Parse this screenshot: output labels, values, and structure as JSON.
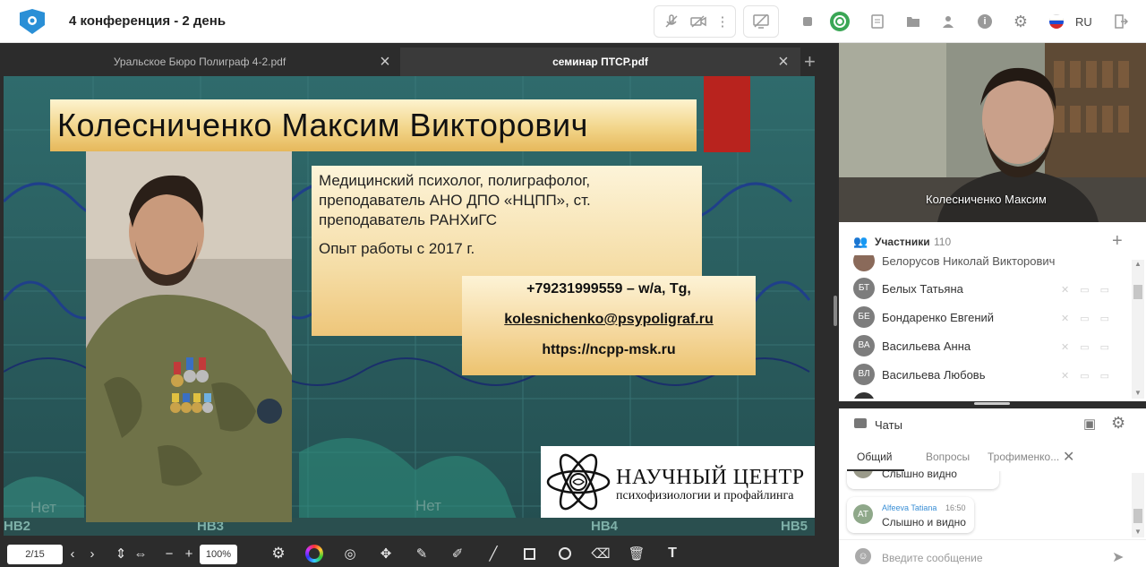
{
  "header": {
    "title": "4 конференция - 2 день",
    "lang": "RU",
    "accent": "#3aa655"
  },
  "doc_tabs": [
    {
      "label": "Уральское Бюро Полиграф 4-2.pdf",
      "active": false
    },
    {
      "label": "семинар ПТСР.pdf",
      "active": true
    }
  ],
  "slide": {
    "name": "Колесниченко Максим Викторович",
    "desc_line1": "Медицинский психолог, полиграфолог,",
    "desc_line2": "преподаватель АНО ДПО «НЦПП», ст.",
    "desc_line3": "преподаватель РАНХиГС",
    "experience": "Опыт работы с 2017 г.",
    "phone": "+79231999559 – w/a, Tg,",
    "email": "kolesnichenko@psypoligraf.ru",
    "website": "https://ncpp-msk.ru",
    "logo_title": "НАУЧНЫЙ ЦЕНТР",
    "logo_subtitle": "психофизиологии и профайлинга",
    "bg_labels": [
      "НВ2",
      "НВ3",
      "НВ4",
      "НВ5",
      "Нет",
      "Нет"
    ]
  },
  "toolbar": {
    "page": "2/15",
    "zoom": "100%"
  },
  "video": {
    "label": "Колесниченко Максим"
  },
  "participants": {
    "label": "Участники",
    "count": "110",
    "items": [
      {
        "initials": "",
        "name": "Белорусов Николай Викторович"
      },
      {
        "initials": "БТ",
        "name": "Белых Татьяна"
      },
      {
        "initials": "БЕ",
        "name": "Бондаренко Евгений"
      },
      {
        "initials": "ВА",
        "name": "Васильева Анна"
      },
      {
        "initials": "ВЛ",
        "name": "Васильева Любовь"
      }
    ]
  },
  "chats": {
    "label": "Чаты",
    "tabs": [
      "Общий",
      "Вопросы",
      "Трофименко..."
    ],
    "messages": [
      {
        "author": "",
        "time": "",
        "text": "Слышно видно",
        "initials": ""
      },
      {
        "author": "Alfeeva Tatiana",
        "time": "16:50",
        "text": "Слышно и видно",
        "initials": "AT"
      }
    ],
    "input_placeholder": "Введите сообщение"
  }
}
